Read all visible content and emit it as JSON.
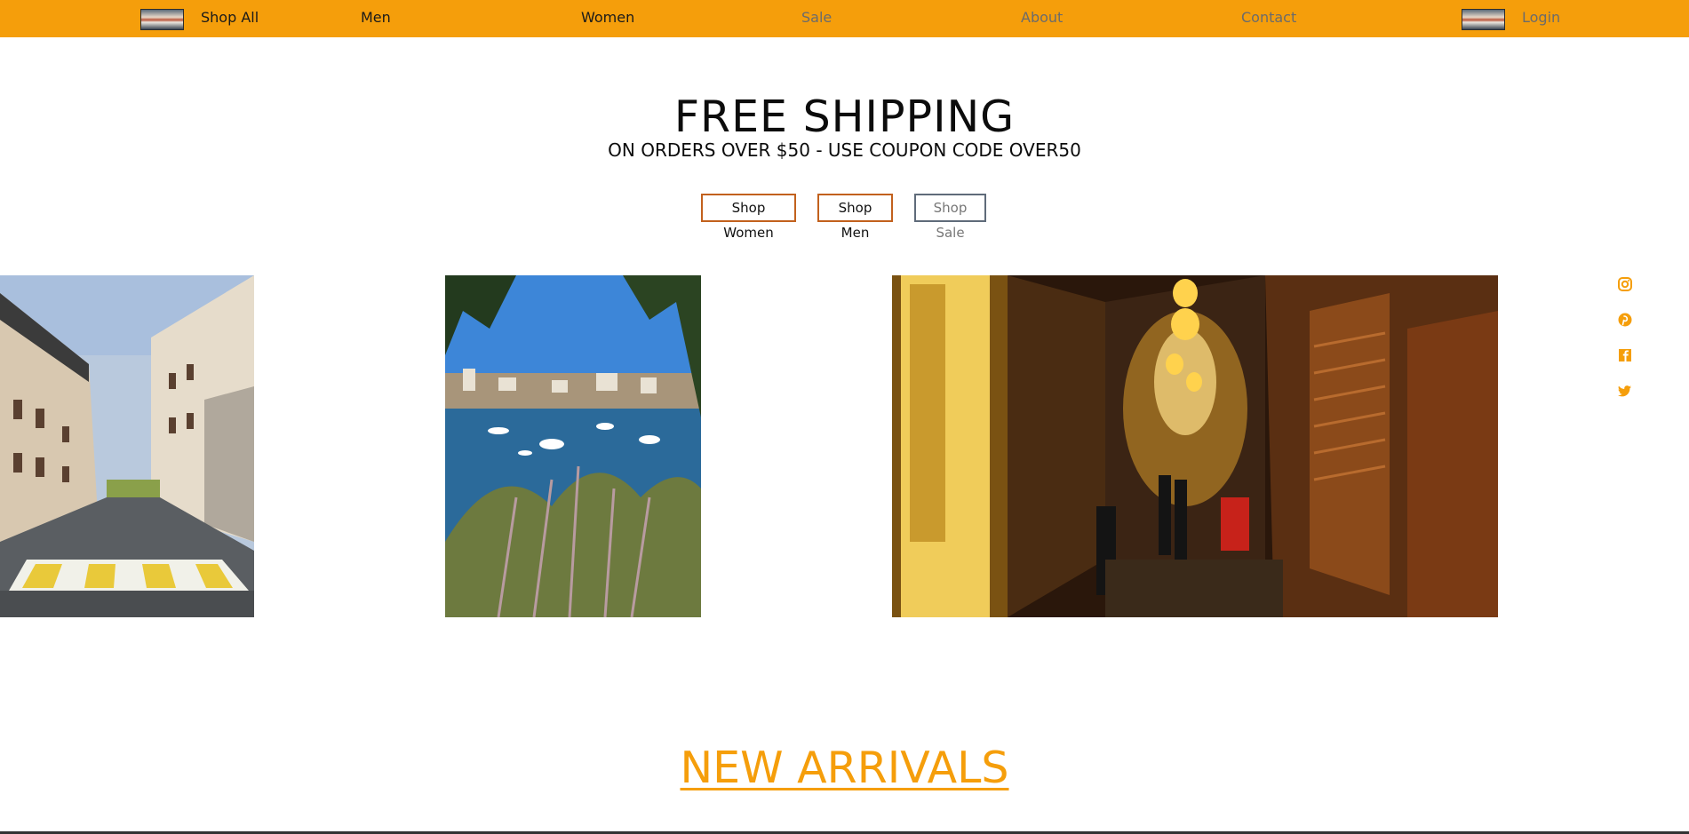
{
  "nav": {
    "items": [
      {
        "label": "Shop All"
      },
      {
        "label": "Men"
      },
      {
        "label": "Women"
      },
      {
        "label": "Sale"
      },
      {
        "label": "About"
      },
      {
        "label": "Contact"
      }
    ],
    "login_label": "Login",
    "bg_color": "#F59E0B"
  },
  "hero": {
    "title": "FREE SHIPPING",
    "subtitle": "ON ORDERS OVER $50 - USE COUPON CODE OVER50",
    "buttons": [
      {
        "label": "Shop Women"
      },
      {
        "label": "Shop Men"
      },
      {
        "label": "Shop Sale"
      }
    ]
  },
  "social": {
    "icons": [
      "instagram-icon",
      "pinterest-icon",
      "facebook-icon",
      "twitter-icon"
    ],
    "color": "#F59E0B"
  },
  "section": {
    "new_arrivals": "NEW ARRIVALS"
  }
}
